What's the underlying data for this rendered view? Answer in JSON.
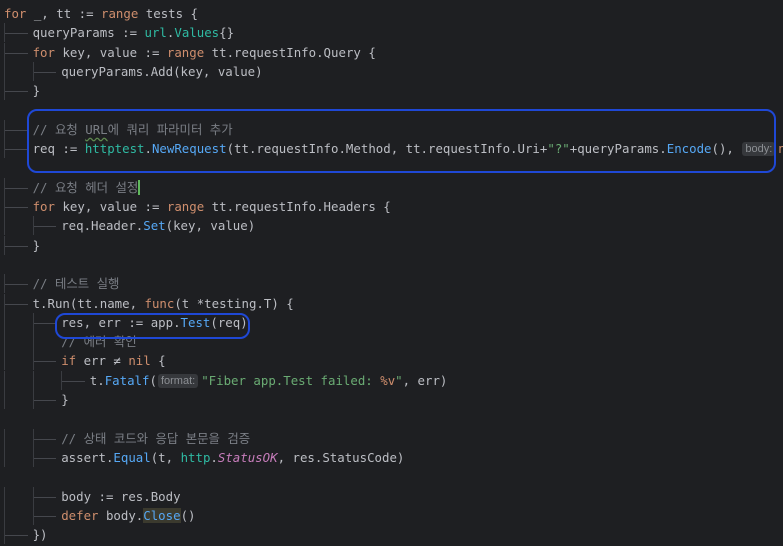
{
  "editor": {
    "language": "go",
    "lines": [
      {
        "tokens": [
          [
            "for",
            "kw"
          ],
          [
            " _, tt := ",
            "op"
          ],
          [
            "range",
            "kw"
          ],
          [
            " tests {",
            "op"
          ]
        ]
      },
      {
        "tokens": [
          [
            "queryParams := ",
            "op"
          ],
          [
            "url",
            "pkg"
          ],
          [
            ".",
            "op"
          ],
          [
            "Values",
            "pkg"
          ],
          [
            "{}",
            "op"
          ]
        ]
      },
      {
        "tokens": [
          [
            "for",
            "kw"
          ],
          [
            " key, value := ",
            "op"
          ],
          [
            "range",
            "kw"
          ],
          [
            " tt.requestInfo.Query {",
            "op"
          ]
        ]
      },
      {
        "tokens": [
          [
            "queryParams.Add(key, value)",
            "op"
          ]
        ]
      },
      {
        "tokens": [
          [
            "}",
            "op"
          ]
        ]
      },
      {
        "tokens": []
      },
      {
        "tokens": [
          [
            "// 요청 ",
            "cmt"
          ],
          [
            "URL",
            "cmt-wavy"
          ],
          [
            "에 쿼리 파라미터 추가",
            "cmt"
          ]
        ]
      },
      {
        "tokens": [
          [
            "req := ",
            "op"
          ],
          [
            "httptest",
            "pkg"
          ],
          [
            ".",
            "op"
          ],
          [
            "NewRequest",
            "fn"
          ],
          [
            "(tt.requestInfo.Method, tt.requestInfo.Uri+",
            "op"
          ],
          [
            "\"?\"",
            "str"
          ],
          [
            "+queryParams.",
            "op"
          ],
          [
            "Encode",
            "fn"
          ],
          [
            "(), ",
            "op"
          ],
          [
            "body:",
            "hint"
          ],
          [
            "nil",
            "kw"
          ],
          [
            ")",
            "op"
          ]
        ]
      },
      {
        "tokens": []
      },
      {
        "tokens": [
          [
            "// 요청 헤더 설정",
            "cmt"
          ],
          [
            "",
            "caret"
          ]
        ]
      },
      {
        "tokens": [
          [
            "for",
            "kw"
          ],
          [
            " key, value := ",
            "op"
          ],
          [
            "range",
            "kw"
          ],
          [
            " tt.requestInfo.Headers {",
            "op"
          ]
        ]
      },
      {
        "tokens": [
          [
            "req.Header.",
            "op"
          ],
          [
            "Set",
            "fn"
          ],
          [
            "(key, value)",
            "op"
          ]
        ]
      },
      {
        "tokens": [
          [
            "}",
            "op"
          ]
        ]
      },
      {
        "tokens": []
      },
      {
        "tokens": [
          [
            "// 테스트 실행",
            "cmt"
          ]
        ]
      },
      {
        "tokens": [
          [
            "t.Run(tt.name, ",
            "op"
          ],
          [
            "func",
            "kw"
          ],
          [
            "(t *testing.T) {",
            "op"
          ]
        ]
      },
      {
        "tokens": [
          [
            "res, err := app.",
            "op"
          ],
          [
            "Test",
            "fn"
          ],
          [
            "(req)",
            "op"
          ]
        ]
      },
      {
        "tokens": [
          [
            "// 에러 확인",
            "cmt"
          ]
        ]
      },
      {
        "tokens": [
          [
            "if",
            "kw"
          ],
          [
            " err ≠ ",
            "op"
          ],
          [
            "nil",
            "kw"
          ],
          [
            " {",
            "op"
          ]
        ]
      },
      {
        "tokens": [
          [
            "t.",
            "op"
          ],
          [
            "Fatalf",
            "fn"
          ],
          [
            "(",
            "op"
          ],
          [
            "format:",
            "hint"
          ],
          [
            "\"Fiber app.Test failed: ",
            "str"
          ],
          [
            "%v",
            "kw"
          ],
          [
            "\"",
            "str"
          ],
          [
            ", err)",
            "op"
          ]
        ]
      },
      {
        "tokens": [
          [
            "}",
            "op"
          ]
        ]
      },
      {
        "tokens": []
      },
      {
        "tokens": [
          [
            "// 상태 코드와 응답 본문을 검증",
            "cmt"
          ]
        ]
      },
      {
        "tokens": [
          [
            "assert.",
            "op"
          ],
          [
            "Equal",
            "fn"
          ],
          [
            "(t, ",
            "op"
          ],
          [
            "http",
            "pkg"
          ],
          [
            ".",
            "op"
          ],
          [
            "StatusOK",
            "it"
          ],
          [
            ", res.StatusCode)",
            "op"
          ]
        ]
      },
      {
        "tokens": []
      },
      {
        "tokens": [
          [
            "body := res.Body",
            "op"
          ]
        ]
      },
      {
        "tokens": [
          [
            "defer",
            "kw"
          ],
          [
            " body.",
            "op"
          ],
          [
            "Close",
            "fn-hl"
          ],
          [
            "()",
            "op"
          ]
        ]
      },
      {
        "tokens": [
          [
            "})",
            "op"
          ]
        ]
      }
    ]
  },
  "colors": {
    "background": "#1e1f22",
    "keyword": "#cf8e6d",
    "function": "#56a8f5",
    "package": "#2fbaa3",
    "string": "#6aab73",
    "comment": "#7a7e85",
    "highlight_box": "#1f48d6"
  }
}
